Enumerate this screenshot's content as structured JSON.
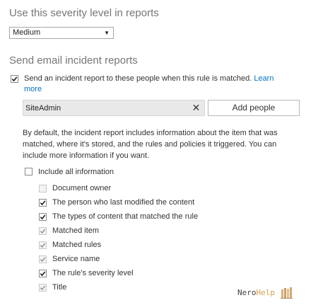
{
  "severity": {
    "title": "Use this severity level in reports",
    "selected": "Medium",
    "arrow_icon": "triangle-down"
  },
  "email": {
    "title": "Send email incident reports",
    "send_checkbox": {
      "checked": true,
      "label": "Send an incident report to these people when this rule is matched.",
      "link_part1": "Learn",
      "link_part2": "more"
    },
    "people_value": "SiteAdmin",
    "remove_label": "✕",
    "add_people_label": "Add people",
    "description_lines": [
      "By default, the incident report includes information about the item that was",
      "matched, where it's stored, and the rules and policies it triggered. You can",
      "include more information if you want."
    ],
    "include_all": {
      "label": "Include all information",
      "checked": false
    },
    "options": [
      {
        "label": "Document owner",
        "checked": false,
        "disabled": true
      },
      {
        "label": "The person who last modified the content",
        "checked": true,
        "disabled": false
      },
      {
        "label": "The types of content that matched the rule",
        "checked": true,
        "disabled": false
      },
      {
        "label": "Matched item",
        "checked": true,
        "disabled": true
      },
      {
        "label": "Matched rules",
        "checked": true,
        "disabled": true
      },
      {
        "label": "Service name",
        "checked": true,
        "disabled": true
      },
      {
        "label": "The rule's severity level",
        "checked": true,
        "disabled": false
      },
      {
        "label": "Title",
        "checked": true,
        "disabled": true
      }
    ]
  },
  "watermark": {
    "part1": "Nero",
    "part2": "Help"
  },
  "colors": {
    "link": "#0072c6",
    "title": "#767676",
    "field_bg": "#e9e9e9"
  }
}
